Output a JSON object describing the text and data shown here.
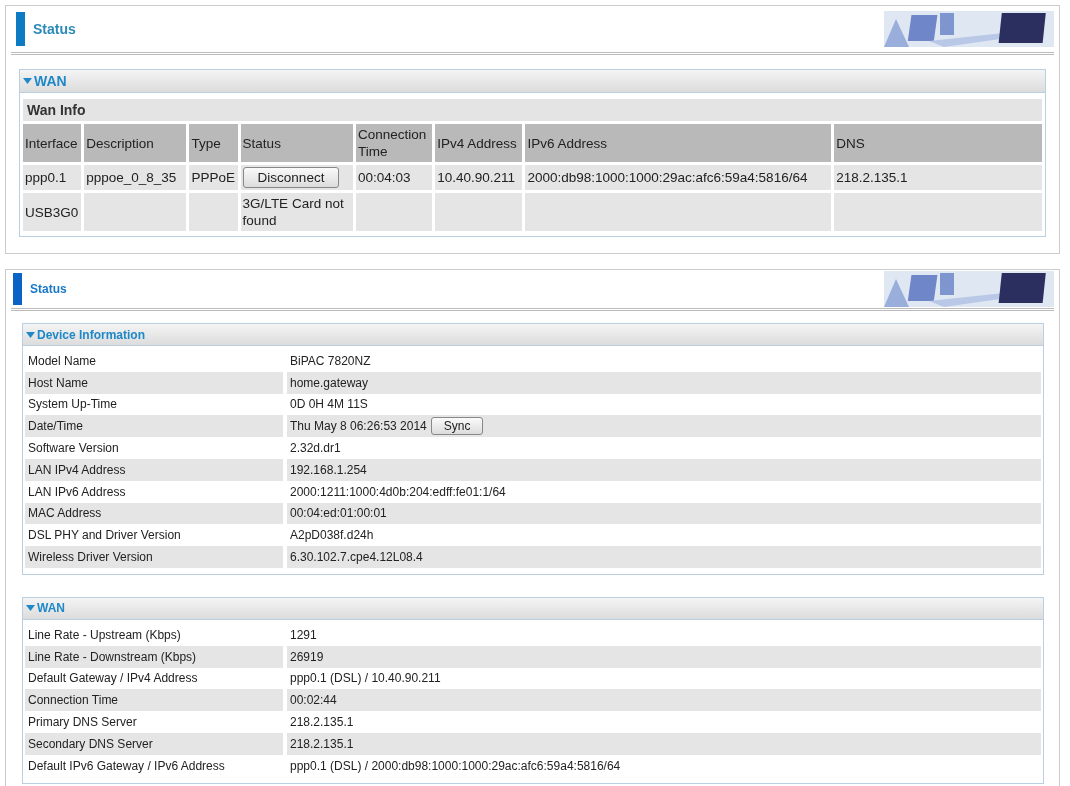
{
  "top_panel": {
    "title": "Status",
    "section": {
      "title": "WAN",
      "expanded": true,
      "subtitle": "Wan Info",
      "columns": [
        "Interface",
        "Description",
        "Type",
        "Status",
        "Connection Time",
        "IPv4 Address",
        "IPv6 Address",
        "DNS"
      ],
      "rows": [
        {
          "cells": [
            {
              "kind": "text",
              "text": "ppp0.1"
            },
            {
              "kind": "text",
              "text": "pppoe_0_8_35"
            },
            {
              "kind": "text",
              "text": "PPPoE"
            },
            {
              "kind": "button",
              "text": "Disconnect"
            },
            {
              "kind": "text",
              "text": "00:04:03"
            },
            {
              "kind": "text",
              "text": "10.40.90.211"
            },
            {
              "kind": "text",
              "text": "2000:db98:1000:1000:29ac:afc6:59a4:5816/64"
            },
            {
              "kind": "text",
              "text": "218.2.135.1"
            }
          ]
        },
        {
          "cells": [
            {
              "kind": "text",
              "text": "USB3G0"
            },
            {
              "kind": "empty"
            },
            {
              "kind": "empty"
            },
            {
              "kind": "text",
              "text": "3G/LTE Card not found"
            },
            {
              "kind": "empty"
            },
            {
              "kind": "empty"
            },
            {
              "kind": "empty"
            },
            {
              "kind": "empty"
            }
          ]
        }
      ]
    }
  },
  "bottom_panel": {
    "title": "Status",
    "sections": [
      {
        "title": "Device Information",
        "expanded": true,
        "rows": [
          {
            "label": "Model Name",
            "value": "BiPAC 7820NZ"
          },
          {
            "label": "Host Name",
            "value": "home.gateway"
          },
          {
            "label": "System Up-Time",
            "value": "0D 0H 4M 11S"
          },
          {
            "label": "Date/Time",
            "value": "Thu May 8 06:26:53 2014",
            "button": "Sync"
          },
          {
            "label": "Software Version",
            "value": "2.32d.dr1"
          },
          {
            "label": "LAN IPv4 Address",
            "value": "192.168.1.254"
          },
          {
            "label": "LAN IPv6 Address",
            "value": "2000:1211:1000:4d0b:204:edff:fe01:1/64"
          },
          {
            "label": "MAC Address",
            "value": "00:04:ed:01:00:01"
          },
          {
            "label": "DSL PHY and Driver Version",
            "value": "A2pD038f.d24h"
          },
          {
            "label": "Wireless Driver Version",
            "value": "6.30.102.7.cpe4.12L08.4"
          }
        ]
      },
      {
        "title": "WAN",
        "expanded": true,
        "rows": [
          {
            "label": "Line Rate - Upstream (Kbps)",
            "value": "1291"
          },
          {
            "label": "Line Rate - Downstream (Kbps)",
            "value": "26919"
          },
          {
            "label": "Default Gateway / IPv4 Address",
            "value": "ppp0.1 (DSL) / 10.40.90.211"
          },
          {
            "label": "Connection Time",
            "value": "00:02:44"
          },
          {
            "label": "Primary DNS Server",
            "value": "218.2.135.1"
          },
          {
            "label": "Secondary DNS Server",
            "value": "218.2.135.1"
          },
          {
            "label": "Default IPv6 Gateway / IPv6 Address",
            "value": "ppp0.1 (DSL) / 2000:db98:1000:1000:29ac:afc6:59a4:5816/64"
          }
        ]
      }
    ]
  }
}
